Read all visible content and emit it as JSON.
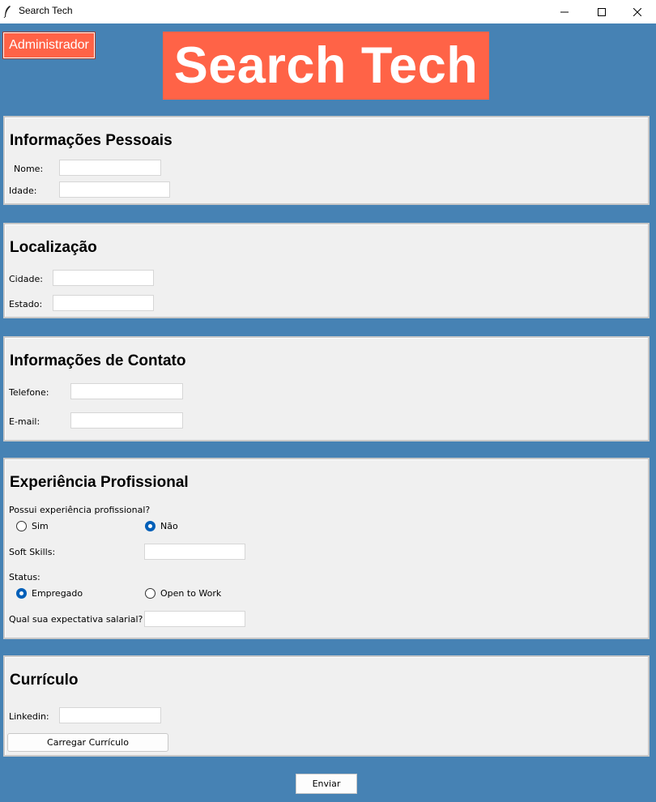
{
  "window": {
    "title": "Search Tech",
    "icon": "feather-icon",
    "controls": [
      "minimize-icon",
      "maximize-icon",
      "close-icon"
    ]
  },
  "header": {
    "admin_button": "Administrador",
    "hero_title": "Search Tech"
  },
  "colors": {
    "background": "#4682b4",
    "accent": "#ff6347",
    "panel": "#f0f0f0",
    "radio_selected": "#005fb8"
  },
  "personal": {
    "title": "Informações Pessoais",
    "name_label": "Nome:",
    "name_value": "",
    "age_label": "Idade:",
    "age_value": ""
  },
  "location": {
    "title": "Localização",
    "city_label": "Cidade:",
    "city_value": "",
    "state_label": "Estado:",
    "state_value": ""
  },
  "contact": {
    "title": "Informações de Contato",
    "phone_label": "Telefone:",
    "phone_value": "",
    "email_label": "E-mail:",
    "email_value": ""
  },
  "experience": {
    "title": "Experiência Profissional",
    "question": "Possui experiência profissional?",
    "options": [
      {
        "label": "Sim",
        "selected": false
      },
      {
        "label": "Não",
        "selected": true
      }
    ],
    "soft_skills_label": "Soft Skills:",
    "soft_skills_value": "",
    "status_label": "Status:",
    "status_options": [
      {
        "label": "Empregado",
        "selected": true
      },
      {
        "label": "Open to Work",
        "selected": false
      }
    ],
    "salary_label": "Qual sua expectativa salarial?",
    "salary_value": ""
  },
  "resume": {
    "title": "Currículo",
    "linkedin_label": "Linkedin:",
    "linkedin_value": "",
    "upload_button": "Carregar Currículo"
  },
  "submit_button": "Enviar"
}
